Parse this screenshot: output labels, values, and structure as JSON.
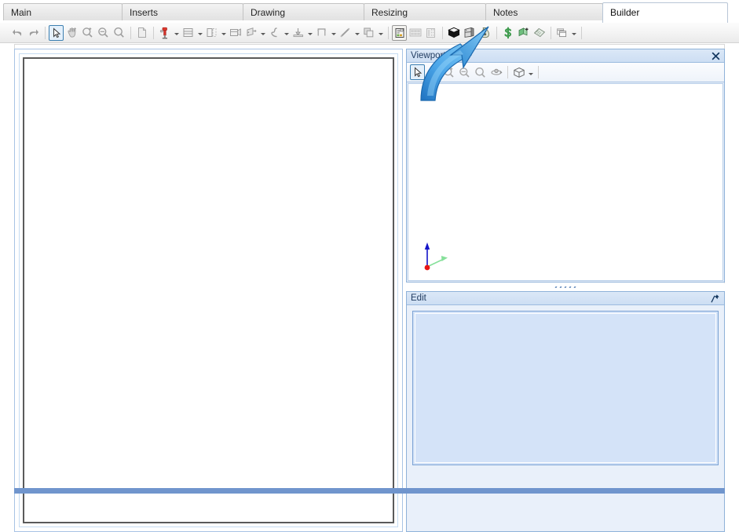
{
  "window": {
    "title": "Builder"
  },
  "tabs": [
    {
      "label": "Main",
      "active": false
    },
    {
      "label": "Inserts",
      "active": false
    },
    {
      "label": "Drawing",
      "active": false
    },
    {
      "label": "Resizing",
      "active": false
    },
    {
      "label": "Notes",
      "active": false
    },
    {
      "label": "Builder",
      "active": true
    }
  ],
  "toolbar": {
    "items": [
      {
        "name": "undo-icon",
        "tooltip": "Undo",
        "kind": "button",
        "state": "disabled"
      },
      {
        "name": "redo-icon",
        "tooltip": "Redo",
        "kind": "button",
        "state": "disabled"
      },
      {
        "name": "separator-1",
        "kind": "separator"
      },
      {
        "name": "select-arrow-icon",
        "tooltip": "Select",
        "kind": "button",
        "state": "selected"
      },
      {
        "name": "pan-hand-icon",
        "tooltip": "Pan",
        "kind": "button",
        "state": "disabled"
      },
      {
        "name": "zoom-in-icon",
        "tooltip": "Zoom In",
        "kind": "button",
        "state": "disabled"
      },
      {
        "name": "zoom-out-icon",
        "tooltip": "Zoom Out",
        "kind": "button",
        "state": "disabled"
      },
      {
        "name": "zoom-window-icon",
        "tooltip": "Zoom",
        "kind": "button",
        "state": "disabled"
      },
      {
        "name": "separator-2",
        "kind": "separator"
      },
      {
        "name": "new-sheet-icon",
        "tooltip": "New Sheet",
        "kind": "button",
        "state": "disabled"
      },
      {
        "name": "separator-3",
        "kind": "separator"
      },
      {
        "name": "drill-tool-icon",
        "tooltip": "Drill Tool",
        "kind": "button",
        "state": "normal",
        "caret": true
      },
      {
        "name": "shelves-icon",
        "tooltip": "Shelves",
        "kind": "button",
        "state": "disabled",
        "caret": true
      },
      {
        "name": "panel-divider-icon",
        "tooltip": "Divider",
        "kind": "button",
        "state": "disabled",
        "caret": true
      },
      {
        "name": "drawer-icon",
        "tooltip": "Drawer",
        "kind": "button",
        "state": "disabled"
      },
      {
        "name": "door-icon",
        "tooltip": "Door",
        "kind": "button",
        "state": "disabled",
        "caret": true
      },
      {
        "name": "curve-edge-icon",
        "tooltip": "Curved Edge",
        "kind": "button",
        "state": "disabled",
        "caret": true
      },
      {
        "name": "plinth-icon",
        "tooltip": "Plinth",
        "kind": "button",
        "state": "disabled",
        "caret": true
      },
      {
        "name": "rail-icon",
        "tooltip": "Rail",
        "kind": "button",
        "state": "disabled",
        "caret": true
      },
      {
        "name": "diagonal-brace-icon",
        "tooltip": "Brace",
        "kind": "button",
        "state": "disabled",
        "caret": true
      },
      {
        "name": "copy-parts-icon",
        "tooltip": "Copy Parts",
        "kind": "button",
        "state": "disabled",
        "caret": true
      },
      {
        "name": "separator-4",
        "kind": "separator"
      },
      {
        "name": "report-icon",
        "tooltip": "Report",
        "kind": "button",
        "state": "framed"
      },
      {
        "name": "grid-layout-icon",
        "tooltip": "Grid Layout",
        "kind": "button",
        "state": "disabled"
      },
      {
        "name": "column-layout-icon",
        "tooltip": "Column Layout",
        "kind": "button",
        "state": "disabled"
      },
      {
        "name": "separator-5",
        "kind": "separator"
      },
      {
        "name": "box-3d-icon",
        "tooltip": "3D Box",
        "kind": "button",
        "state": "normal"
      },
      {
        "name": "cabinet-icon",
        "tooltip": "Cabinet",
        "kind": "button",
        "state": "normal"
      },
      {
        "name": "money-bag-icon",
        "tooltip": "Costing",
        "kind": "button",
        "state": "normal"
      },
      {
        "name": "separator-6",
        "kind": "separator"
      },
      {
        "name": "dollar-icon",
        "tooltip": "Price",
        "kind": "button",
        "state": "normal"
      },
      {
        "name": "add-material-icon",
        "tooltip": "Add Material",
        "kind": "button",
        "state": "normal"
      },
      {
        "name": "catalog-book-icon",
        "tooltip": "Catalog",
        "kind": "button",
        "state": "normal"
      },
      {
        "name": "separator-7",
        "kind": "separator"
      },
      {
        "name": "windows-cascade-icon",
        "tooltip": "Windows",
        "kind": "button",
        "state": "disabled",
        "caret": true
      },
      {
        "name": "separator-8",
        "kind": "separator"
      }
    ]
  },
  "canvas": {
    "name": "drawing-canvas",
    "content": ""
  },
  "viewport": {
    "title": "Viewport",
    "close_label": "✕",
    "toolbar": [
      {
        "name": "vp-select-arrow-icon",
        "tooltip": "Select",
        "state": "selected"
      },
      {
        "name": "vp-pan-hand-icon",
        "tooltip": "Pan",
        "state": "disabled"
      },
      {
        "name": "vp-zoom-in-icon",
        "tooltip": "Zoom In",
        "state": "disabled"
      },
      {
        "name": "vp-zoom-out-icon",
        "tooltip": "Zoom Out",
        "state": "disabled"
      },
      {
        "name": "vp-zoom-window-icon",
        "tooltip": "Zoom",
        "state": "disabled"
      },
      {
        "name": "vp-orbit-icon",
        "tooltip": "Orbit",
        "state": "disabled"
      },
      {
        "name": "vp-separator-1",
        "kind": "separator"
      },
      {
        "name": "vp-view-cube-icon",
        "tooltip": "View",
        "state": "normal",
        "caret": true
      }
    ],
    "axis_gizmo": {
      "z_axis_color": "#1414c8",
      "y_axis_color": "#86e09a",
      "origin_color": "#e81414"
    }
  },
  "edit_panel": {
    "title": "Edit",
    "pin_label": "pin-icon",
    "value": ""
  },
  "annotation": {
    "arrow": {
      "name": "annotation-arrow",
      "color_light": "#5fb3ef",
      "color_dark": "#1466b3",
      "points_to": "box-3d-icon"
    }
  },
  "colors": {
    "accent": "#3c7fb1",
    "panel_border": "#8fb2d9",
    "panel_title_bg": "#cddef3",
    "status_band": "#7095cd",
    "edit_box_bg": "#d4e3f8"
  }
}
